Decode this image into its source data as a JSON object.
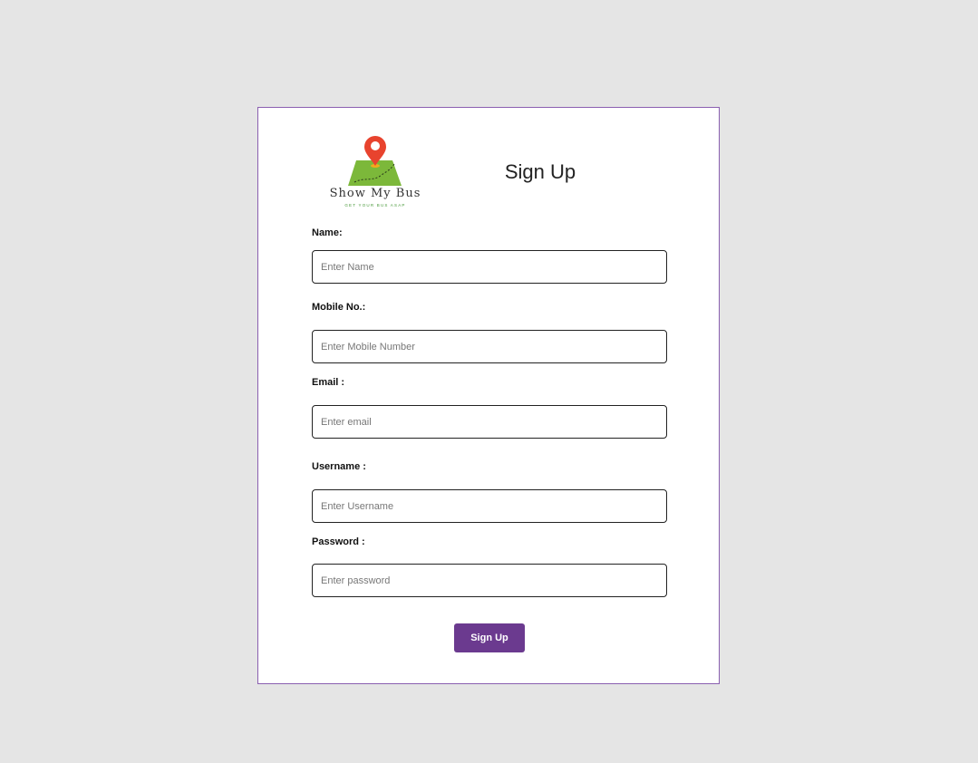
{
  "brand": {
    "name": "Show My Bus",
    "tagline": "GET YOUR BUS ASAP"
  },
  "form": {
    "title": "Sign Up",
    "fields": [
      {
        "label": "Name:",
        "placeholder": "Enter Name",
        "value": ""
      },
      {
        "label": "Mobile No.:",
        "placeholder": "Enter Mobile Number",
        "value": ""
      },
      {
        "label": "Email :",
        "placeholder": "Enter email",
        "value": ""
      },
      {
        "label": "Username :",
        "placeholder": "Enter Username",
        "value": ""
      },
      {
        "label": "Password :",
        "placeholder": "Enter password",
        "value": ""
      }
    ],
    "submit_label": "Sign Up"
  },
  "colors": {
    "page_background": "#e5e5e5",
    "card_border": "#8a5fb0",
    "button": "#6b3a8f",
    "pin": "#e8432e",
    "map": "#7cb83a"
  }
}
